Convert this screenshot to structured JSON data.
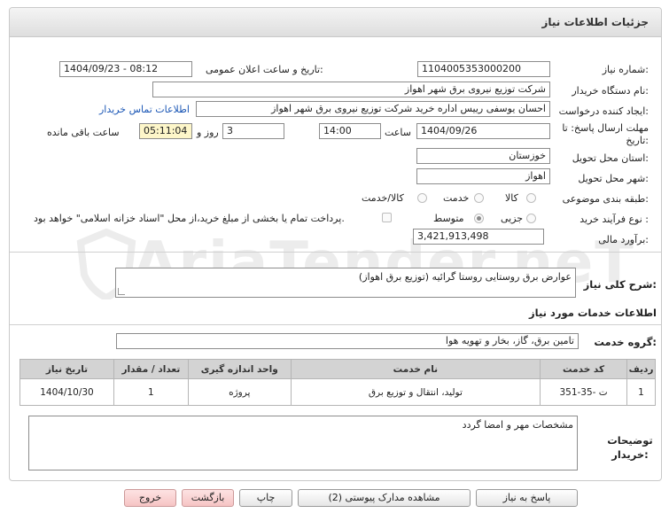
{
  "panel": {
    "title": "جزئیات اطلاعات نیاز"
  },
  "watermark": "AriaTender.neT",
  "form": {
    "need_number_label": "شماره نیاز:",
    "need_number": "1104005353000200",
    "announce_label": "تاریخ و ساعت اعلان عمومی:",
    "announce_value": "1404/09/23 - 08:12",
    "buyer_org_label": "نام دستگاه خریدار:",
    "buyer_org": "شرکت توزیع نیروی برق شهر اهواز",
    "creator_label": "ایجاد کننده درخواست:",
    "creator": "احسان یوسفی رییس اداره خرید شرکت توزیع نیروی برق شهر اهواز",
    "contact_link": "اطلاعات تماس خریدار",
    "deadline_label": "مهلت ارسال پاسخ: تا تاریخ:",
    "deadline_date": "1404/09/26",
    "time_label": "ساعت",
    "deadline_time": "14:00",
    "days_value": "3",
    "days_label": "روز و",
    "remaining_time": "05:11:04",
    "remaining_label": "ساعت باقی مانده",
    "province_label": "استان محل تحویل:",
    "province": "خوزستان",
    "city_label": "شهر محل تحویل:",
    "city": "اهواز",
    "category_label": "طبقه بندی موضوعی:",
    "category_options": [
      "کالا",
      "خدمت",
      "کالا/خدمت"
    ],
    "process_label": "نوع فرآیند خرید :",
    "process_options": [
      "جزیی",
      "متوسط"
    ],
    "payment_note": "پرداخت تمام یا بخشی از مبلغ خرید،از محل \"اسناد خزانه اسلامی\" خواهد بود.",
    "budget_label": "برآورد مالی:",
    "budget": "3,421,913,498"
  },
  "summary": {
    "label": "شرح کلی نیاز:",
    "text": "عوارض برق روستایی روستا گرائیه (توزیع برق اهواز)"
  },
  "services": {
    "section_title": "اطلاعات خدمات مورد نیاز",
    "group_label": "گروه خدمت:",
    "group_value": "تامین برق، گاز، بخار و تهویه هوا",
    "headers": [
      "ردیف",
      "کد خدمت",
      "نام خدمت",
      "واحد اندازه گیری",
      "تعداد / مقدار",
      "تاریخ نیاز"
    ],
    "rows": [
      {
        "idx": "1",
        "code": "ت -35-351",
        "name": "تولید، انتقال و توزیع برق",
        "unit": "پروژه",
        "qty": "1",
        "date": "1404/10/30"
      }
    ]
  },
  "buyer_notes": {
    "label": "توضیحات خریدار:",
    "text": "مشخصات مهر و امضا گردد"
  },
  "buttons": {
    "reply": "پاسخ به نیاز",
    "attachments": "مشاهده مدارک پیوستی (2)",
    "print": "چاپ",
    "back": "بازگشت",
    "exit": "خروج"
  }
}
